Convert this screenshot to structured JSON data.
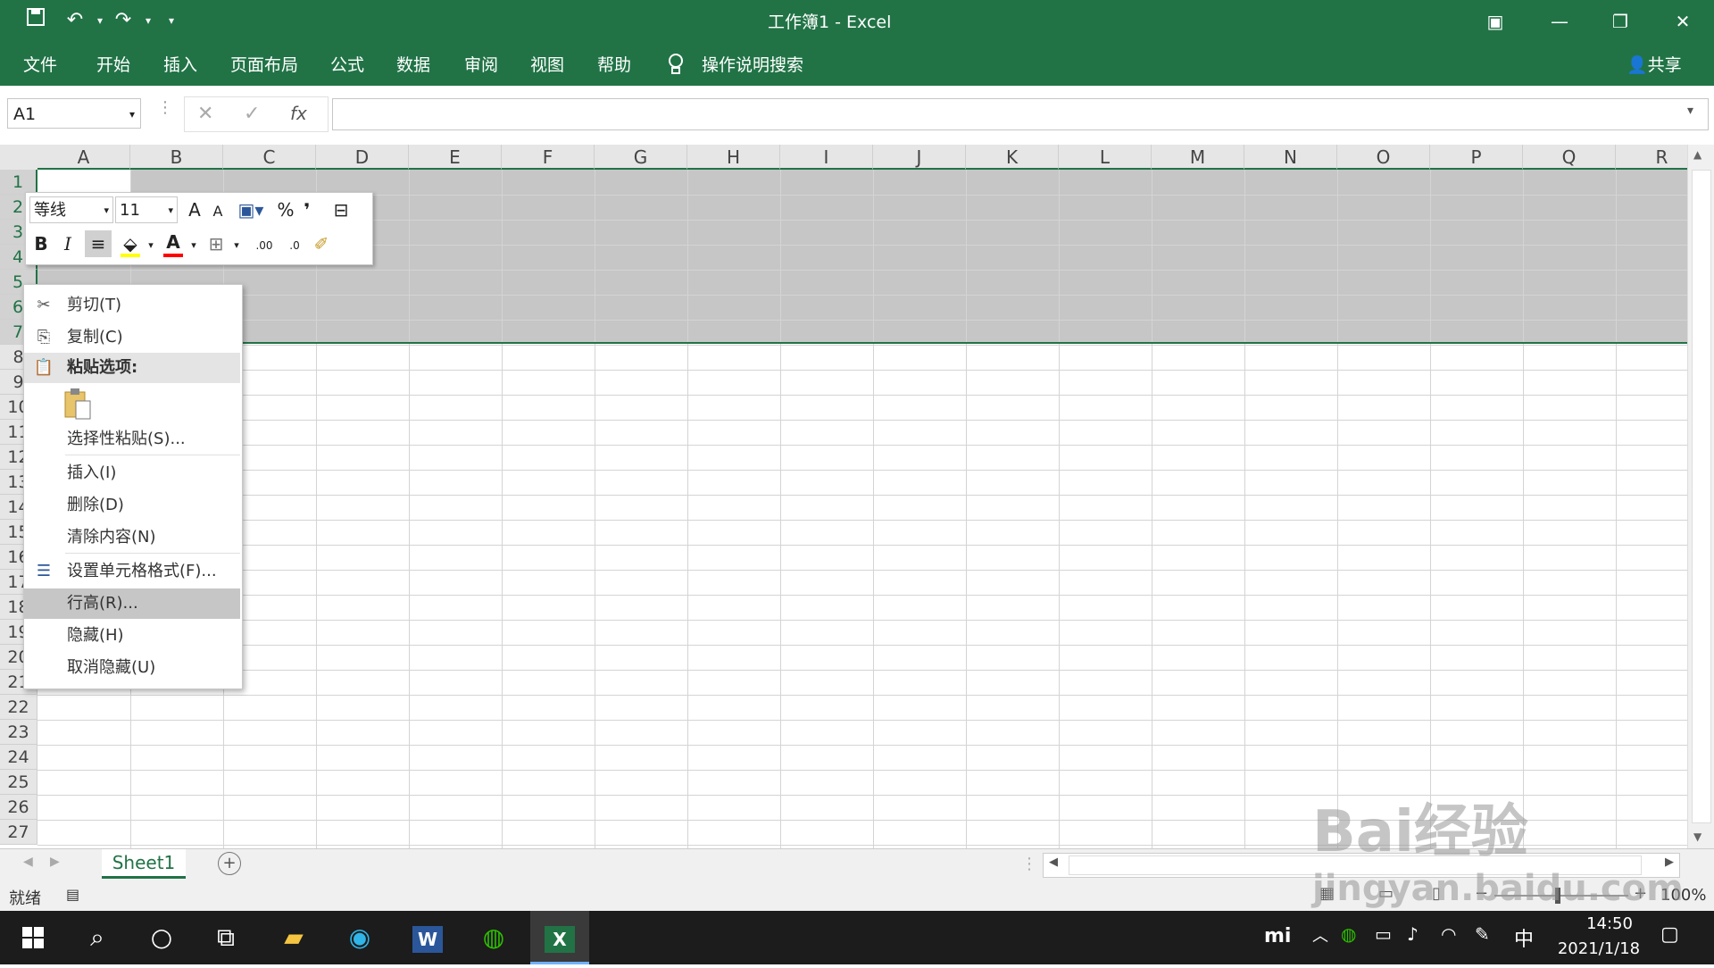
{
  "window": {
    "title": "工作簿1  -  Excel",
    "qat": {
      "save_icon": "save-icon",
      "undo_icon": "undo-icon",
      "redo_icon": "redo-icon"
    },
    "controls": {
      "ribbon_display": "ribbon-display-icon",
      "minimize": "minimize-icon",
      "restore": "restore-icon",
      "close": "close-icon"
    }
  },
  "ribbon": {
    "tabs": [
      "文件",
      "开始",
      "插入",
      "页面布局",
      "公式",
      "数据",
      "审阅",
      "视图",
      "帮助"
    ],
    "tell_me": "操作说明搜索",
    "share": "共享"
  },
  "formula_bar": {
    "name_box": "A1",
    "fx": "fx",
    "value": ""
  },
  "grid": {
    "columns": [
      "A",
      "B",
      "C",
      "D",
      "E",
      "F",
      "G",
      "H",
      "I",
      "J",
      "K",
      "L",
      "M",
      "N",
      "O",
      "P",
      "Q",
      "R"
    ],
    "rows": [
      "1",
      "2",
      "3",
      "4",
      "5",
      "6",
      "7",
      "8",
      "9",
      "10",
      "11",
      "12",
      "13",
      "14",
      "15",
      "16",
      "17",
      "18",
      "19",
      "20",
      "21",
      "22",
      "23",
      "24",
      "25",
      "26",
      "27"
    ],
    "selected_rows": [
      "1",
      "2",
      "3",
      "4",
      "5",
      "6",
      "7"
    ]
  },
  "mini_toolbar": {
    "font_name": "等线",
    "font_size": "11",
    "bold": "B",
    "italic": "I",
    "percent": "%",
    "comma": "❜",
    "grow_font": "A",
    "shrink_font": "A",
    "font_color_letter": "A",
    "increase_decimal": ".00",
    "decrease_decimal": ".0",
    "fill_color": "#ffff00",
    "font_color": "#ff0000"
  },
  "context_menu": {
    "items": [
      {
        "label": "剪切(T)",
        "icon": "scissors-icon"
      },
      {
        "label": "复制(C)",
        "icon": "copy-icon"
      },
      {
        "label": "粘贴选项:",
        "icon": "paste-icon"
      },
      {
        "label": "",
        "icon": "paste-option-icon"
      },
      {
        "label": "选择性粘贴(S)...",
        "icon": ""
      },
      {
        "label": "插入(I)",
        "icon": ""
      },
      {
        "label": "删除(D)",
        "icon": ""
      },
      {
        "label": "清除内容(N)",
        "icon": ""
      },
      {
        "label": "设置单元格格式(F)...",
        "icon": "format-cells-icon"
      },
      {
        "label": "行高(R)...",
        "icon": ""
      },
      {
        "label": "隐藏(H)",
        "icon": ""
      },
      {
        "label": "取消隐藏(U)",
        "icon": ""
      }
    ]
  },
  "sheets": {
    "tabs": [
      "Sheet1"
    ],
    "add": "+"
  },
  "status": {
    "ready": "就绪",
    "zoom": "100%"
  },
  "taskbar": {
    "time": "14:50",
    "date": "2021/1/18",
    "ime": "中"
  },
  "watermark": {
    "line1": "Bai经验",
    "line2": "jingyan.baidu.com"
  }
}
